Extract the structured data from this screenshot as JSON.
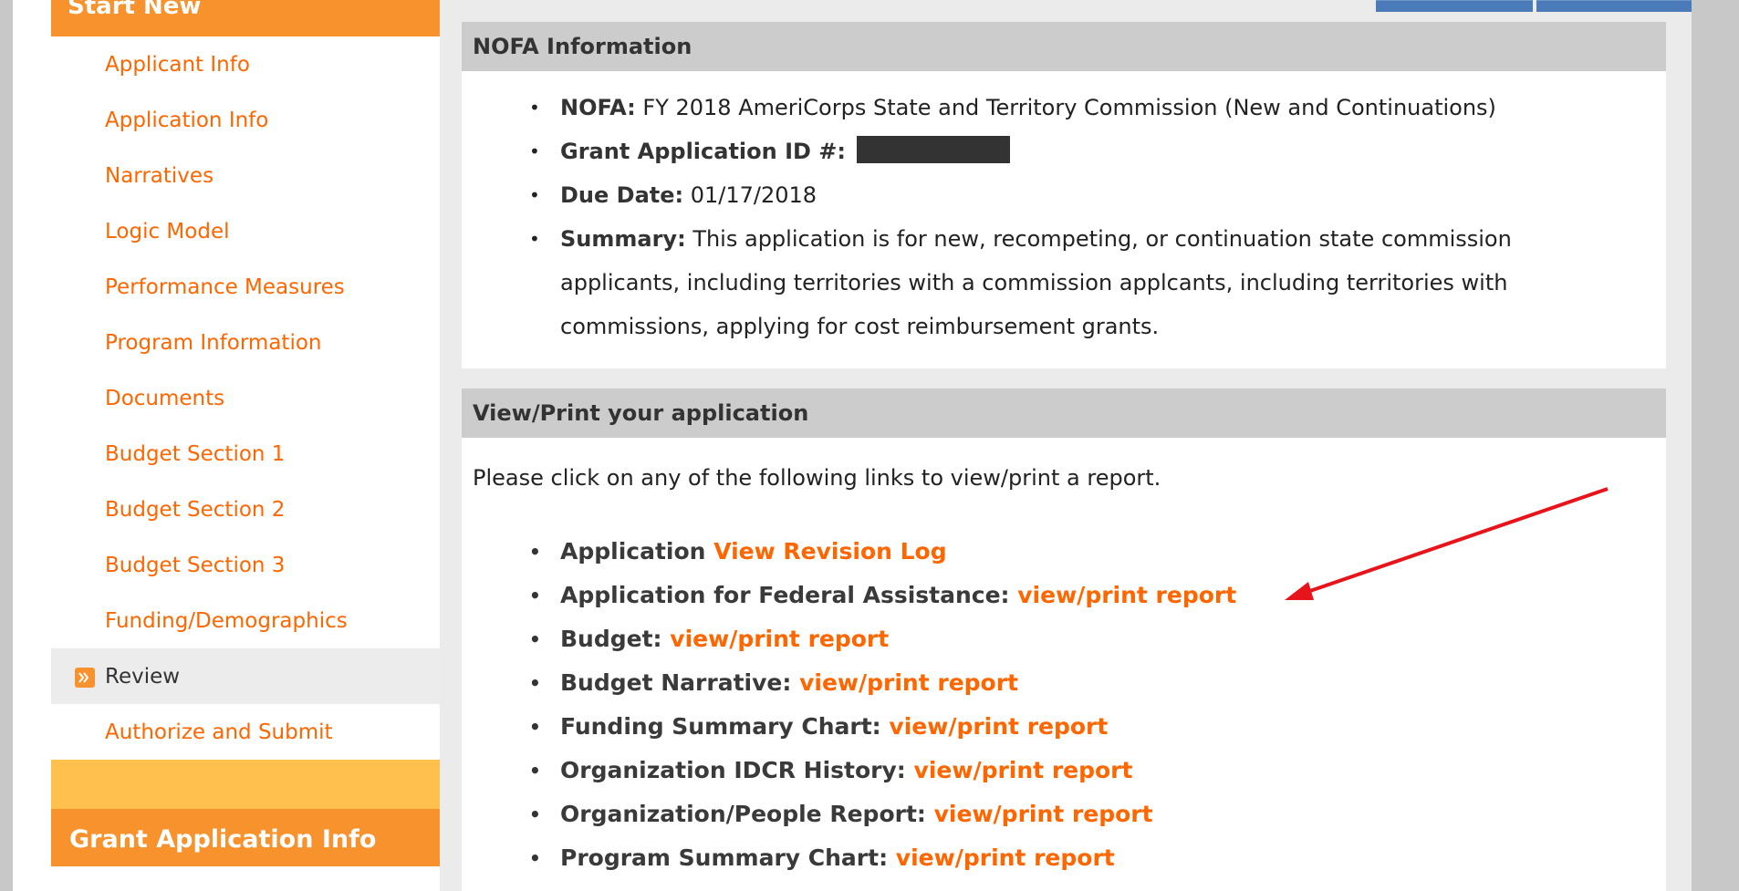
{
  "sidebar": {
    "header": "Start New",
    "items": [
      {
        "label": "Applicant Info"
      },
      {
        "label": "Application Info"
      },
      {
        "label": "Narratives"
      },
      {
        "label": "Logic Model"
      },
      {
        "label": "Performance Measures"
      },
      {
        "label": "Program Information"
      },
      {
        "label": "Documents"
      },
      {
        "label": "Budget Section 1"
      },
      {
        "label": "Budget Section 2"
      },
      {
        "label": "Budget Section 3"
      },
      {
        "label": "Funding/Demographics"
      },
      {
        "label": "Review",
        "active": true,
        "icon": "arrow-right-icon"
      },
      {
        "label": "Authorize and Submit"
      }
    ],
    "footer": "Grant Application Info"
  },
  "nofa": {
    "title": "NOFA Information",
    "nofa_label": "NOFA:",
    "nofa_value": "FY 2018 AmeriCorps State and Territory Commission (New and Continuations)",
    "grant_id_label": "Grant Application ID #:",
    "due_date_label": "Due Date:",
    "due_date_value": "01/17/2018",
    "summary_label": "Summary:",
    "summary_value": "This application is for new, recompeting, or continuation state commission applicants, including territories with a commission applcants, including territories with commissions, applying for cost reimbursement grants."
  },
  "view_print": {
    "title": "View/Print your application",
    "intro": "Please click on any of the following links to view/print a report.",
    "reports": [
      {
        "label": "Application",
        "link": "View Revision Log"
      },
      {
        "label": "Application for Federal Assistance:",
        "link": "view/print report"
      },
      {
        "label": "Budget:",
        "link": "view/print report"
      },
      {
        "label": "Budget Narrative:",
        "link": "view/print report"
      },
      {
        "label": "Funding Summary Chart:",
        "link": "view/print report"
      },
      {
        "label": "Organization IDCR History:",
        "link": "view/print report"
      },
      {
        "label": "Organization/People Report:",
        "link": "view/print report"
      },
      {
        "label": "Program Summary Chart:",
        "link": "view/print report"
      }
    ]
  },
  "colors": {
    "accent_orange": "#f7922d",
    "link_orange": "#ff6600",
    "annotation_red": "#e8141b"
  }
}
